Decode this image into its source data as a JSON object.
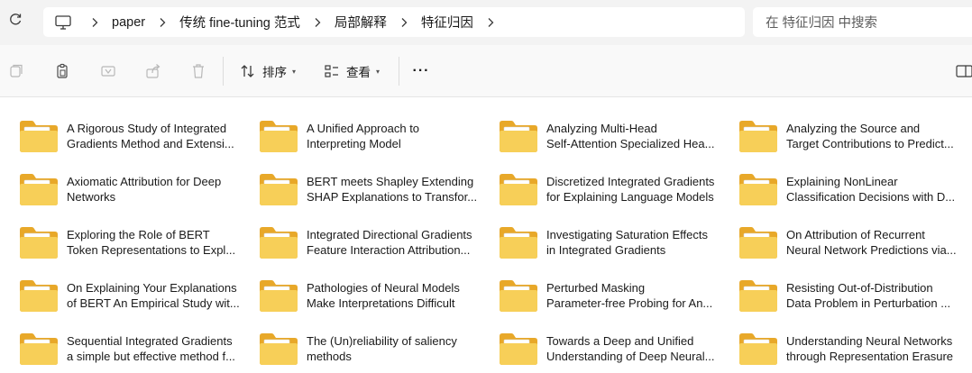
{
  "address_bar": {
    "breadcrumbs": [
      "paper",
      "传统 fine-tuning 范式",
      "局部解释",
      "特征归因"
    ],
    "search_placeholder": "在 特征归因 中搜索"
  },
  "toolbar": {
    "sort_label": "排序",
    "view_label": "查看",
    "more_label": "···"
  },
  "files": [
    {
      "line1": "A Rigorous Study of Integrated",
      "line2": "Gradients Method and Extensi..."
    },
    {
      "line1": "A Unified Approach to",
      "line2": "Interpreting Model"
    },
    {
      "line1": "Analyzing Multi-Head",
      "line2": "Self-Attention Specialized Hea..."
    },
    {
      "line1": "Analyzing the Source and",
      "line2": "Target Contributions to Predict..."
    },
    {
      "line1": "Axiomatic Attribution for Deep",
      "line2": "Networks"
    },
    {
      "line1": "BERT meets Shapley Extending",
      "line2": "SHAP Explanations to Transfor..."
    },
    {
      "line1": "Discretized Integrated Gradients",
      "line2": "for Explaining Language Models"
    },
    {
      "line1": "Explaining NonLinear",
      "line2": "Classification Decisions with D..."
    },
    {
      "line1": "Exploring the Role of BERT",
      "line2": "Token Representations to Expl..."
    },
    {
      "line1": "Integrated Directional Gradients",
      "line2": "Feature Interaction Attribution..."
    },
    {
      "line1": "Investigating Saturation Effects",
      "line2": "in Integrated Gradients"
    },
    {
      "line1": "On Attribution of Recurrent",
      "line2": "Neural Network Predictions via..."
    },
    {
      "line1": "On Explaining Your Explanations",
      "line2": "of BERT An Empirical Study wit..."
    },
    {
      "line1": "Pathologies of Neural Models",
      "line2": "Make Interpretations Difficult"
    },
    {
      "line1": "Perturbed Masking",
      "line2": "Parameter-free Probing for An..."
    },
    {
      "line1": "Resisting Out-of-Distribution",
      "line2": "Data Problem in Perturbation ..."
    },
    {
      "line1": "Sequential Integrated Gradients",
      "line2": "a simple but effective method f..."
    },
    {
      "line1": "The (Un)reliability of saliency",
      "line2": "methods"
    },
    {
      "line1": "Towards a Deep and Unified",
      "line2": "Understanding of Deep Neural..."
    },
    {
      "line1": "Understanding Neural Networks",
      "line2": "through Representation Erasure"
    }
  ],
  "icons": {
    "refresh": "refresh-icon",
    "computer": "computer-icon",
    "folder": "folder-icon",
    "folder_color": "#f6c84b",
    "folder_paper_stripe": "#c42b3b"
  }
}
